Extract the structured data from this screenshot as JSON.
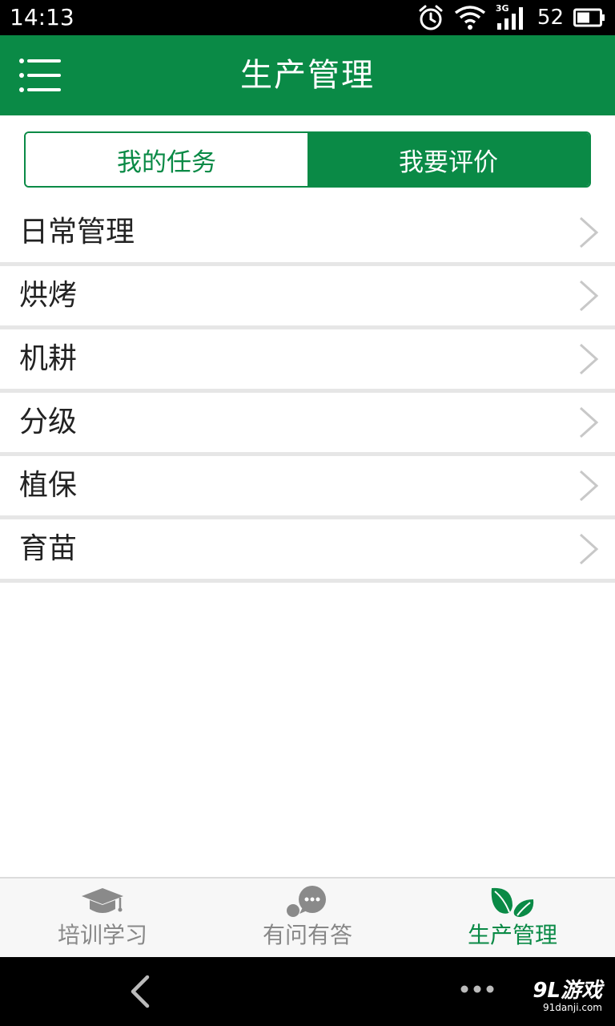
{
  "status_bar": {
    "time": "14:13",
    "battery": "52",
    "network": "3G",
    "icons": [
      "alarm-icon",
      "wifi-icon",
      "cell-signal-icon",
      "battery-icon"
    ]
  },
  "header": {
    "title": "生产管理",
    "menu_icon": "hamburger-menu-icon"
  },
  "tabs": [
    {
      "label": "我的任务",
      "active": false
    },
    {
      "label": "我要评价",
      "active": true
    }
  ],
  "list": {
    "items": [
      {
        "label": "日常管理"
      },
      {
        "label": "烘烤"
      },
      {
        "label": "机耕"
      },
      {
        "label": "分级"
      },
      {
        "label": "植保"
      },
      {
        "label": "育苗"
      }
    ]
  },
  "bottom_nav": {
    "items": [
      {
        "label": "培训学习",
        "icon": "graduation-cap-icon",
        "active": false
      },
      {
        "label": "有问有答",
        "icon": "chat-bubble-icon",
        "active": false
      },
      {
        "label": "生产管理",
        "icon": "leaf-icon",
        "active": true
      }
    ]
  },
  "system_nav": {
    "watermark_main": "9L游戏",
    "watermark_sub": "91danji.com"
  },
  "colors": {
    "brand_green": "#0a8a46",
    "divider": "#e6e6e6",
    "inactive_nav": "#888888"
  }
}
